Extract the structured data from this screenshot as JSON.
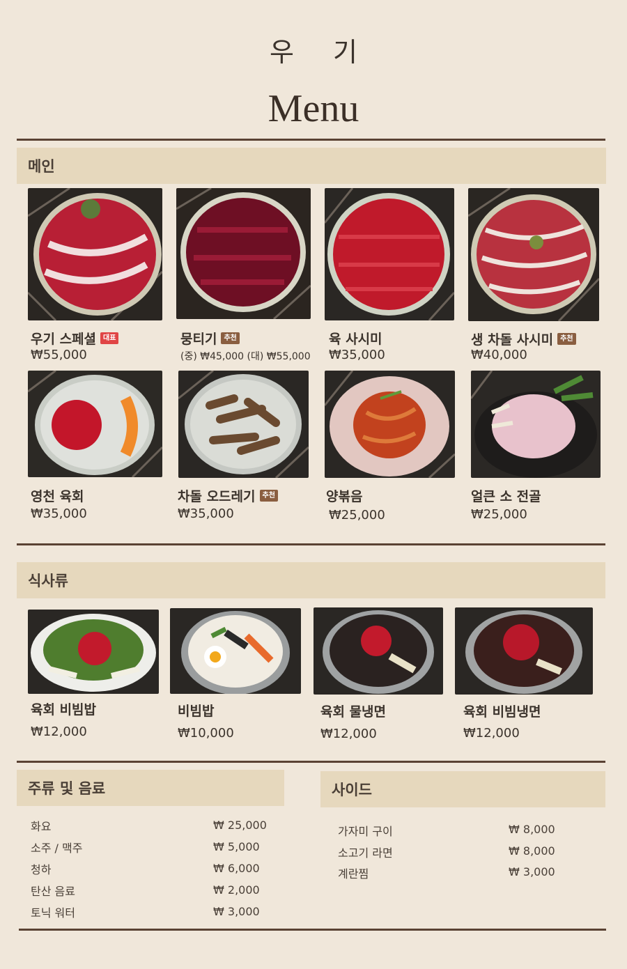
{
  "header": {
    "brand": "우 기",
    "title": "Menu"
  },
  "sections": {
    "main": "메인",
    "meal": "식사류",
    "drinks": "주류 및 음료",
    "side": "사이드"
  },
  "main_items": [
    {
      "name": "우기 스페셜",
      "badge": "대표",
      "price": "₩55,000"
    },
    {
      "name": "뭉티기",
      "badge": "추천",
      "price": "(중) ₩45,000 (대) ₩55,000"
    },
    {
      "name": "육 사시미",
      "badge": "",
      "price": "₩35,000"
    },
    {
      "name": "생 차돌 사시미",
      "badge": "추천",
      "price": "₩40,000"
    },
    {
      "name": "영천 육회",
      "badge": "",
      "price": "₩35,000"
    },
    {
      "name": "차돌 오드레기",
      "badge": "추천",
      "price": "₩35,000"
    },
    {
      "name": "양볶음",
      "badge": "",
      "price": "₩25,000"
    },
    {
      "name": "얼큰 소 전골",
      "badge": "",
      "price": "₩25,000"
    }
  ],
  "meal_items": [
    {
      "name": "육회 비빔밥",
      "price": "₩12,000"
    },
    {
      "name": "비빔밥",
      "price": "₩10,000"
    },
    {
      "name": "육회 물냉면",
      "price": "₩12,000"
    },
    {
      "name": "육회 비빔냉면",
      "price": "₩12,000"
    }
  ],
  "drinks": [
    {
      "name": "화요",
      "price": "₩ 25,000"
    },
    {
      "name": "소주 / 맥주",
      "price": "₩ 5,000"
    },
    {
      "name": "청하",
      "price": "₩ 6,000"
    },
    {
      "name": "탄산 음료",
      "price": "₩ 2,000"
    },
    {
      "name": "토닉 워터",
      "price": "₩ 3,000"
    }
  ],
  "sides": [
    {
      "name": "가자미 구이",
      "price": "₩ 8,000"
    },
    {
      "name": "소고기 라면",
      "price": "₩ 8,000"
    },
    {
      "name": "계란찜",
      "price": "₩ 3,000"
    }
  ],
  "colors": {
    "background": "#f0e7da",
    "section_bar": "#e6d8bd",
    "rule": "#5a4233",
    "badge_red": "#e04545",
    "badge_brown": "#8a5e40"
  }
}
